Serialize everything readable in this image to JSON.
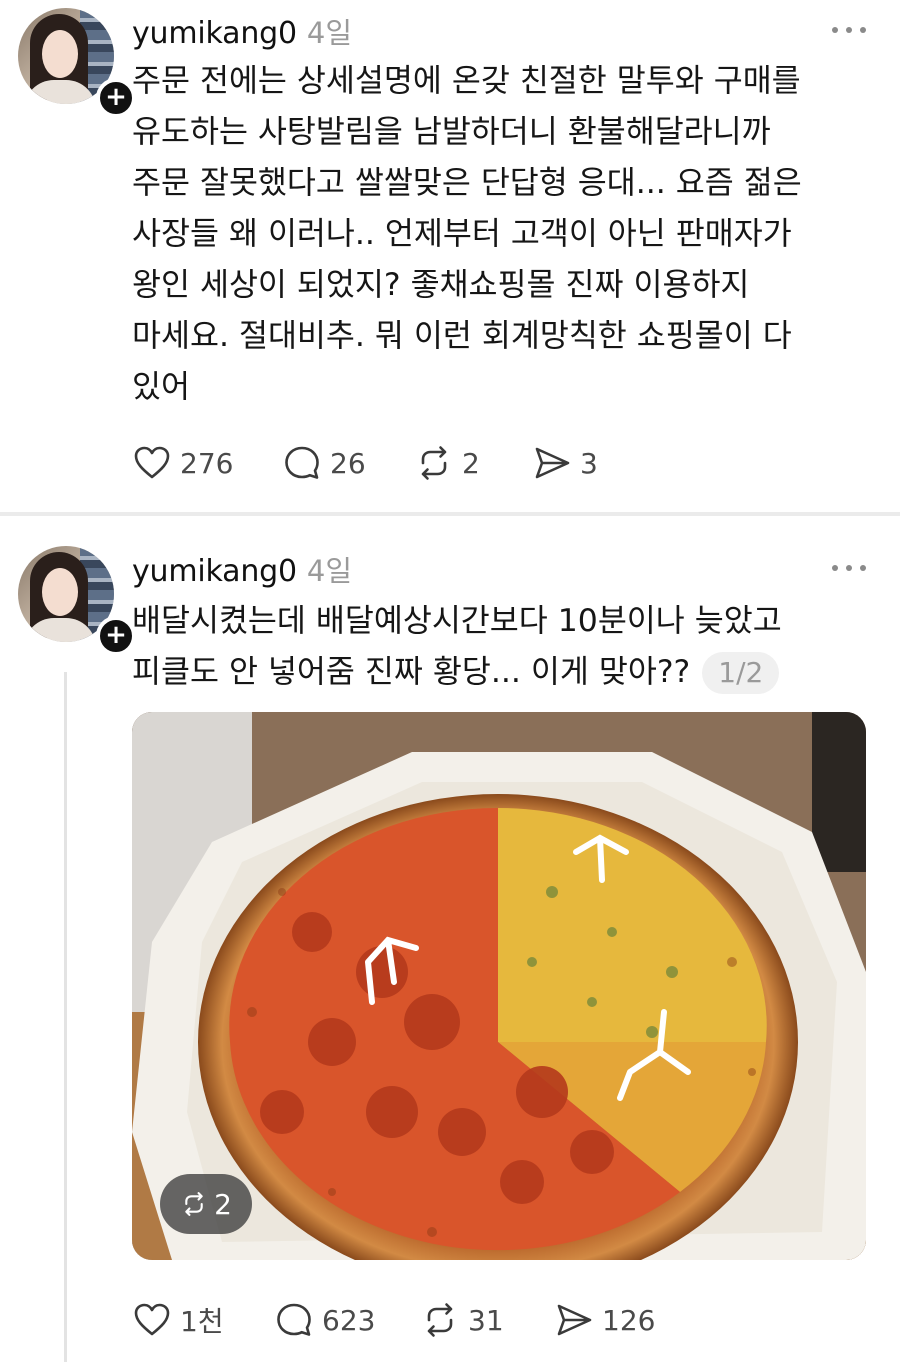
{
  "posts": [
    {
      "username": "yumikang0",
      "time": "4일",
      "lines": [
        "주문 전에는 상세설명에 온갖 친절한 말투와 구매를",
        "유도하는 사탕발림을 남발하더니 환불해달라니까",
        "주문 잘못했다고 쌀쌀맞은 단답형 응대... 요즘 젊은",
        "사장들 왜 이러나.. 언제부터 고객이 아닌 판매자가",
        "왕인 세상이 되었지? 좋채쇼핑몰 진짜 이용하지",
        "마세요. 절대비추. 뭐 이런 회계망칙한 쇼핑몰이 다",
        "있어"
      ],
      "stats": {
        "likes": "276",
        "replies": "26",
        "reposts": "2",
        "shares": "3"
      }
    },
    {
      "username": "yumikang0",
      "time": "4일",
      "lines": [
        "배달시켰는데 배달예상시간보다 10분이나 늦았고",
        "피클도 안 넣어줌 진짜 황당... 이게 맞아??"
      ],
      "page_indicator": "1/2",
      "image_repost_count": "2",
      "stats": {
        "likes": "1천",
        "replies": "623",
        "reposts": "31",
        "shares": "126"
      }
    }
  ],
  "icons": {
    "like": "heart-icon",
    "reply": "speech-bubble-icon",
    "repost": "repost-arrows-icon",
    "share": "send-icon",
    "more": "more-dots-icon",
    "follow": "plus-icon"
  }
}
